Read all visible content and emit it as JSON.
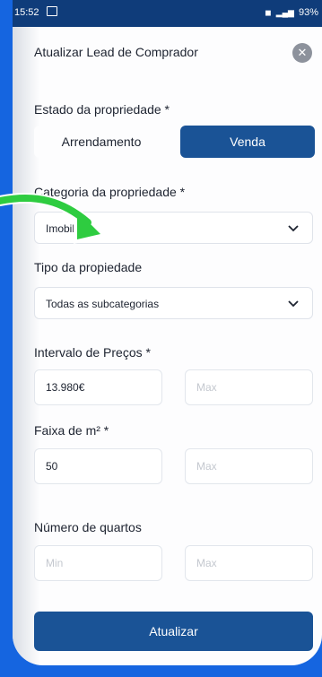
{
  "status_bar": {
    "time": "15:52",
    "battery": "93%"
  },
  "header": {
    "title": "Atualizar Lead de Comprador",
    "close": "✕"
  },
  "property_state": {
    "label": "Estado da propriedade *",
    "options": [
      "Arrendamento",
      "Venda"
    ],
    "selected": "Venda"
  },
  "property_category": {
    "label": "Categoria da propriedade *",
    "value": "Imobiliaire"
  },
  "property_type": {
    "label": "Tipo da propiedade",
    "value": "Todas as subcategorias"
  },
  "price_range": {
    "label": "Intervalo de Preços *",
    "min": "13.980€",
    "max_placeholder": "Max"
  },
  "area_range": {
    "label": "Faixa de m² *",
    "min": "50",
    "max_placeholder": "Max"
  },
  "rooms": {
    "label": "Número de quartos",
    "min_placeholder": "Min",
    "max_placeholder": "Max"
  },
  "submit": {
    "label": "Atualizar"
  },
  "colors": {
    "primary": "#1a5396",
    "background": "#1565e0",
    "arrow": "#2ecc40"
  }
}
